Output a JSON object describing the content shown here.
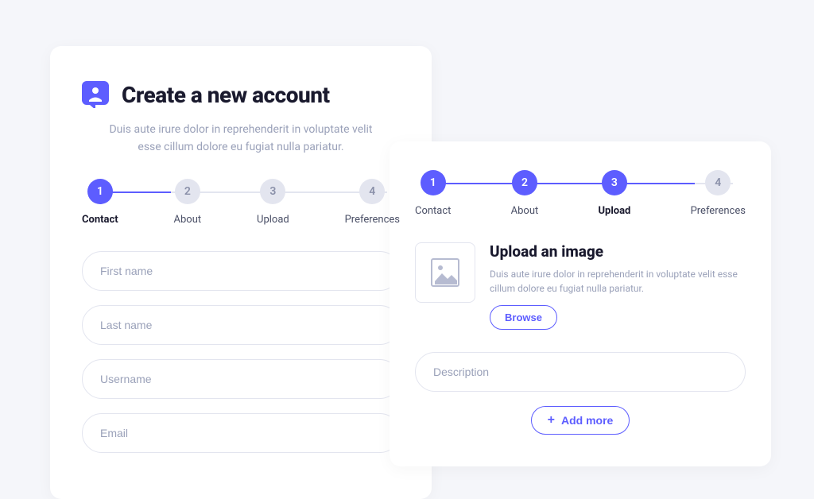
{
  "colors": {
    "accent": "#5d5dff",
    "muted": "#e3e5ef",
    "text_muted": "#9aa1b9",
    "text": "#1a1a2e"
  },
  "card_a": {
    "title": "Create a new account",
    "subtitle": "Duis aute irure dolor in reprehenderit in voluptate velit esse cillum dolore eu fugiat nulla pariatur.",
    "steps": [
      {
        "num": "1",
        "label": "Contact",
        "active": true,
        "current": true
      },
      {
        "num": "2",
        "label": "About",
        "active": false,
        "current": false
      },
      {
        "num": "3",
        "label": "Upload",
        "active": false,
        "current": false
      },
      {
        "num": "4",
        "label": "Preferences",
        "active": false,
        "current": false
      }
    ],
    "fields": {
      "first_name_placeholder": "First name",
      "last_name_placeholder": "Last name",
      "username_placeholder": "Username",
      "email_placeholder": "Email"
    }
  },
  "card_b": {
    "steps": [
      {
        "num": "1",
        "label": "Contact",
        "active": true,
        "current": false
      },
      {
        "num": "2",
        "label": "About",
        "active": true,
        "current": false
      },
      {
        "num": "3",
        "label": "Upload",
        "active": true,
        "current": true
      },
      {
        "num": "4",
        "label": "Preferences",
        "active": false,
        "current": false
      }
    ],
    "upload": {
      "title": "Upload an image",
      "text": "Duis aute irure dolor in reprehenderit in voluptate velit esse cillum dolore eu fugiat nulla pariatur.",
      "browse_label": "Browse"
    },
    "description_placeholder": "Description",
    "add_more_label": "Add more"
  }
}
